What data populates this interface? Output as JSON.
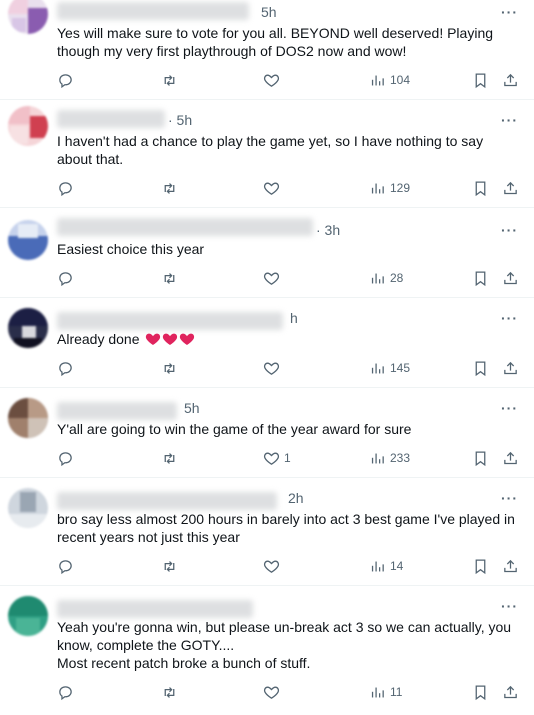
{
  "icons": {
    "reply": "reply-icon",
    "retweet": "retweet-icon",
    "like": "heart-icon",
    "views": "views-icon",
    "bookmark": "bookmark-icon",
    "share": "share-icon",
    "more": "more-icon"
  },
  "colors": {
    "heart": "#e0245e",
    "muted": "#536471"
  },
  "replies": [
    {
      "time": "5h",
      "more": "···",
      "text": "Yes will make sure to vote for you all. BEYOND well deserved! Playing though my very first playthrough of DOS2 now and wow!",
      "likes": "",
      "views": "104"
    },
    {
      "time": "· 5h",
      "more": "···",
      "text": "I haven't had a chance to play the game yet, so I have nothing to say about that.",
      "likes": "",
      "views": "129"
    },
    {
      "time": "· 3h",
      "more": "···",
      "text": "Easiest choice this year",
      "likes": "",
      "views": "28"
    },
    {
      "time": "h",
      "more": "···",
      "text": "Already done",
      "likes": "",
      "views": "145"
    },
    {
      "time": "5h",
      "more": "···",
      "text": "Y'all are going to win the game of the year award for sure",
      "likes": "1",
      "views": "233"
    },
    {
      "time": "2h",
      "more": "···",
      "text": "bro say less almost 200 hours in barely into act 3 best game I've played in recent years not just this year",
      "likes": "",
      "views": "14"
    },
    {
      "time": "",
      "more": "···",
      "text": "Yeah you're gonna win, but please un-break act 3 so we can actually, you know, complete the GOTY....\nMost recent patch broke a bunch of stuff.",
      "likes": "",
      "views": "11"
    }
  ]
}
